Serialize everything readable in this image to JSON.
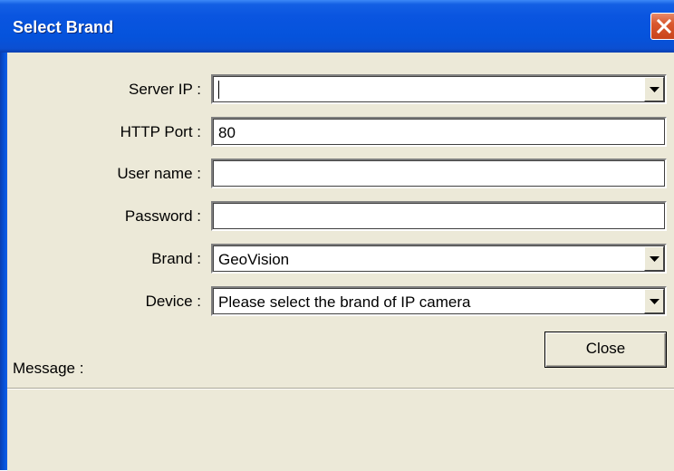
{
  "window": {
    "title": "Select Brand",
    "close_icon": "close-x-icon"
  },
  "form": {
    "server_ip": {
      "label": "Server IP :",
      "value": ""
    },
    "http_port": {
      "label": "HTTP Port :",
      "value": "80"
    },
    "user_name": {
      "label": "User name :",
      "value": ""
    },
    "password": {
      "label": "Password :",
      "value": ""
    },
    "brand": {
      "label": "Brand :",
      "value": "GeoVision"
    },
    "device": {
      "label": "Device :",
      "value": "Please select the brand of IP camera"
    }
  },
  "buttons": {
    "close_label": "Close"
  },
  "message": {
    "label": "Message :",
    "text": ""
  },
  "colors": {
    "titlebar": "#0553dc",
    "dialog_bg": "#ece9d8",
    "close_x": "#d9582f"
  },
  "icons": {
    "dropdown": "triangle-down-icon"
  }
}
